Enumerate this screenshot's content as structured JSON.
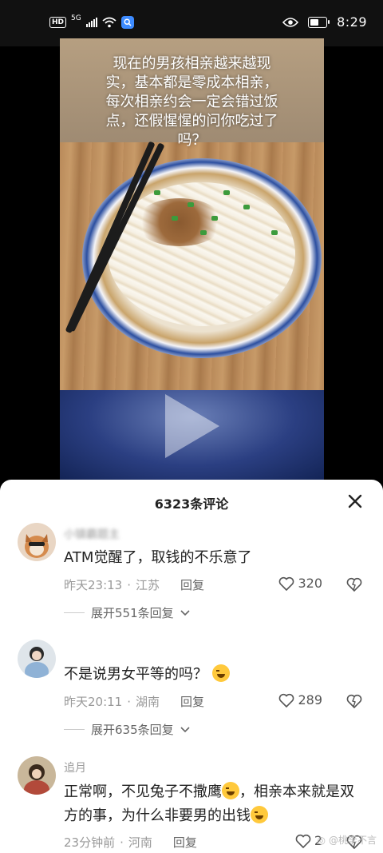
{
  "status_bar": {
    "hd": "HD",
    "network": "5G",
    "time": "8:29",
    "battery_level": 0.45
  },
  "video": {
    "caption": "现在的男孩相亲越来越现实，基本都是零成本相亲，每次相亲约会一定会错过饭点，还假惺惺的问你吃过了吗？"
  },
  "comments_header": {
    "title": "6323条评论"
  },
  "comments": [
    {
      "user": "小镇霸题主",
      "text": "ATM觉醒了，取钱的不乐意了",
      "time": "昨天23:13",
      "location": "江苏",
      "reply_label": "回复",
      "likes": "320",
      "expand_label": "展开551条回复"
    },
    {
      "user": "",
      "text": "不是说男女平等的吗？",
      "time": "昨天20:11",
      "location": "湖南",
      "reply_label": "回复",
      "likes": "289",
      "expand_label": "展开635条回复"
    },
    {
      "user": "追月",
      "text_part1": "正常啊，不见兔子不撒鹰",
      "text_part2": "，相亲本来就是双方的事，为什么非要男的出钱",
      "time": "23分钟前",
      "location": "河南",
      "reply_label": "回复",
      "likes": "2"
    }
  ],
  "watermark": "@桃李不言"
}
